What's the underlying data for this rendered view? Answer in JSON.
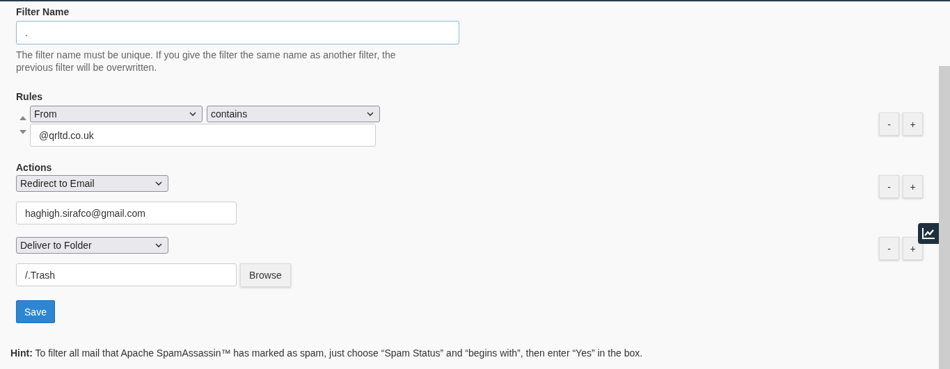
{
  "filter_name": {
    "label": "Filter Name",
    "value": ".",
    "help": "The filter name must be unique. If you give the filter the same name as another filter, the previous filter will be overwritten."
  },
  "rules": {
    "label": "Rules",
    "items": [
      {
        "field": "From",
        "operator": "contains",
        "value": "@qrltd.co.uk",
        "remove": "-",
        "add": "+"
      }
    ]
  },
  "actions": {
    "label": "Actions",
    "items": [
      {
        "kind": "email",
        "action": "Redirect to Email",
        "value": "haghigh.sirafco@gmail.com",
        "remove": "-",
        "add": "+"
      },
      {
        "kind": "folder",
        "action": "Deliver to Folder",
        "value": "/.Trash",
        "browse": "Browse",
        "remove": "-",
        "add": "+"
      }
    ]
  },
  "save": "Save",
  "hint": "**Hint:** To filter all mail that Apache SpamAssassin™ has marked as spam, just choose “Spam Status” and “begins with”, then enter “Yes” in the box."
}
